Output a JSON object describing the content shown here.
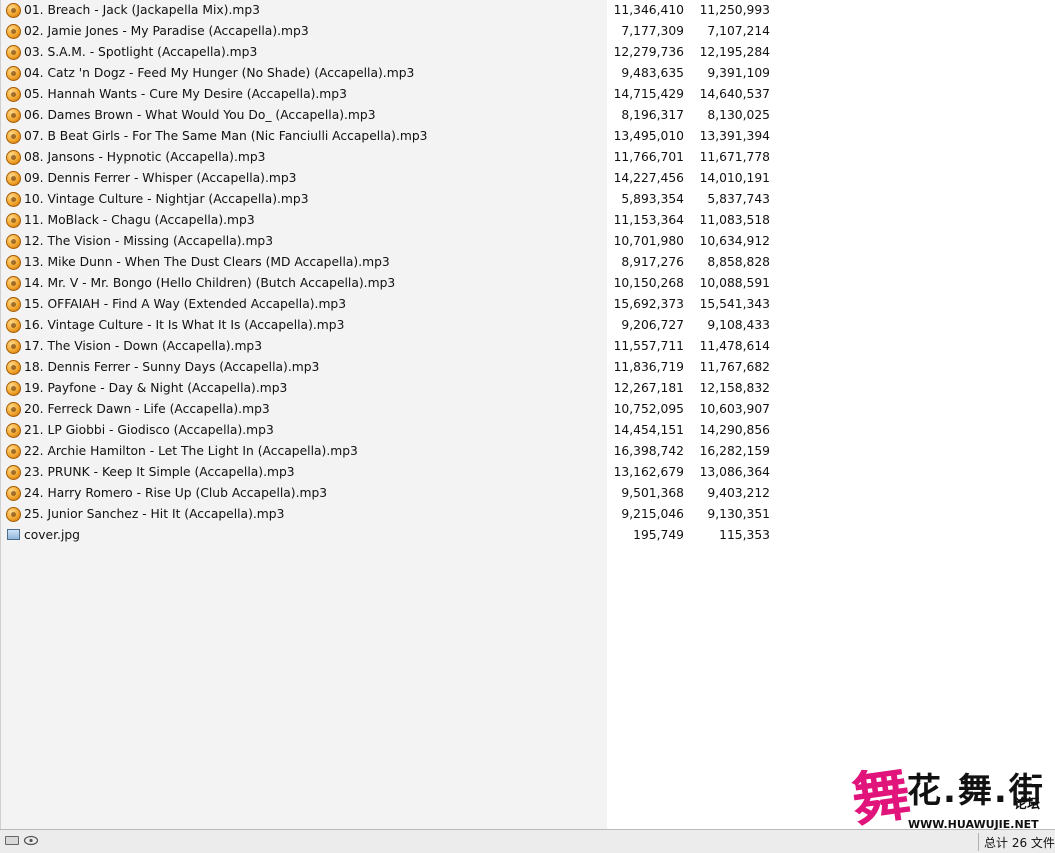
{
  "files": [
    {
      "name": "01. Breach - Jack (Jackapella Mix).mp3",
      "size": "11,346,410",
      "packed": "11,250,993",
      "icon": "audio-file-icon"
    },
    {
      "name": "02. Jamie Jones - My Paradise (Accapella).mp3",
      "size": "7,177,309",
      "packed": "7,107,214",
      "icon": "audio-file-icon"
    },
    {
      "name": "03. S.A.M. - Spotlight (Accapella).mp3",
      "size": "12,279,736",
      "packed": "12,195,284",
      "icon": "audio-file-icon"
    },
    {
      "name": "04. Catz 'n Dogz - Feed My Hunger (No Shade) (Accapella).mp3",
      "size": "9,483,635",
      "packed": "9,391,109",
      "icon": "audio-file-icon"
    },
    {
      "name": "05. Hannah Wants - Cure My Desire (Accapella).mp3",
      "size": "14,715,429",
      "packed": "14,640,537",
      "icon": "audio-file-icon"
    },
    {
      "name": "06. Dames Brown - What Would You Do_ (Accapella).mp3",
      "size": "8,196,317",
      "packed": "8,130,025",
      "icon": "audio-file-icon"
    },
    {
      "name": "07. B Beat Girls - For The Same Man (Nic Fanciulli Accapella).mp3",
      "size": "13,495,010",
      "packed": "13,391,394",
      "icon": "audio-file-icon"
    },
    {
      "name": "08. Jansons - Hypnotic (Accapella).mp3",
      "size": "11,766,701",
      "packed": "11,671,778",
      "icon": "audio-file-icon"
    },
    {
      "name": "09. Dennis Ferrer - Whisper (Accapella).mp3",
      "size": "14,227,456",
      "packed": "14,010,191",
      "icon": "audio-file-icon"
    },
    {
      "name": "10. Vintage Culture - Nightjar (Accapella).mp3",
      "size": "5,893,354",
      "packed": "5,837,743",
      "icon": "audio-file-icon"
    },
    {
      "name": "11. MoBlack - Chagu (Accapella).mp3",
      "size": "11,153,364",
      "packed": "11,083,518",
      "icon": "audio-file-icon"
    },
    {
      "name": "12. The Vision - Missing (Accapella).mp3",
      "size": "10,701,980",
      "packed": "10,634,912",
      "icon": "audio-file-icon"
    },
    {
      "name": "13. Mike Dunn - When The Dust Clears (MD Accapella).mp3",
      "size": "8,917,276",
      "packed": "8,858,828",
      "icon": "audio-file-icon"
    },
    {
      "name": "14. Mr. V - Mr. Bongo (Hello Children) (Butch Accapella).mp3",
      "size": "10,150,268",
      "packed": "10,088,591",
      "icon": "audio-file-icon"
    },
    {
      "name": "15. OFFAIAH - Find A Way (Extended Accapella).mp3",
      "size": "15,692,373",
      "packed": "15,541,343",
      "icon": "audio-file-icon"
    },
    {
      "name": "16. Vintage Culture - It Is What It Is (Accapella).mp3",
      "size": "9,206,727",
      "packed": "9,108,433",
      "icon": "audio-file-icon"
    },
    {
      "name": "17. The Vision - Down (Accapella).mp3",
      "size": "11,557,711",
      "packed": "11,478,614",
      "icon": "audio-file-icon"
    },
    {
      "name": "18. Dennis Ferrer - Sunny Days (Accapella).mp3",
      "size": "11,836,719",
      "packed": "11,767,682",
      "icon": "audio-file-icon"
    },
    {
      "name": "19. Payfone - Day & Night (Accapella).mp3",
      "size": "12,267,181",
      "packed": "12,158,832",
      "icon": "audio-file-icon"
    },
    {
      "name": "20. Ferreck Dawn - Life (Accapella).mp3",
      "size": "10,752,095",
      "packed": "10,603,907",
      "icon": "audio-file-icon"
    },
    {
      "name": "21. LP Giobbi - Giodisco (Accapella).mp3",
      "size": "14,454,151",
      "packed": "14,290,856",
      "icon": "audio-file-icon"
    },
    {
      "name": "22. Archie Hamilton - Let The Light In (Accapella).mp3",
      "size": "16,398,742",
      "packed": "16,282,159",
      "icon": "audio-file-icon"
    },
    {
      "name": "23. PRUNK - Keep It Simple (Accapella).mp3",
      "size": "13,162,679",
      "packed": "13,086,364",
      "icon": "audio-file-icon"
    },
    {
      "name": "24. Harry Romero - Rise Up (Club Accapella).mp3",
      "size": "9,501,368",
      "packed": "9,403,212",
      "icon": "audio-file-icon"
    },
    {
      "name": "25. Junior Sanchez - Hit It (Accapella).mp3",
      "size": "9,215,046",
      "packed": "9,130,351",
      "icon": "audio-file-icon"
    },
    {
      "name": "cover.jpg",
      "size": "195,749",
      "packed": "115,353",
      "icon": "image-file-icon"
    }
  ],
  "statusbar": {
    "total_text": "总计 26 文件",
    "drive_icon": "drive-icon",
    "network_icon": "network-icon"
  },
  "watermark": {
    "logo_text": "花.舞.街",
    "sub_text": "论坛",
    "url": "WWW.HUAWUJIE.NET",
    "accent_color": "#e0147a"
  }
}
